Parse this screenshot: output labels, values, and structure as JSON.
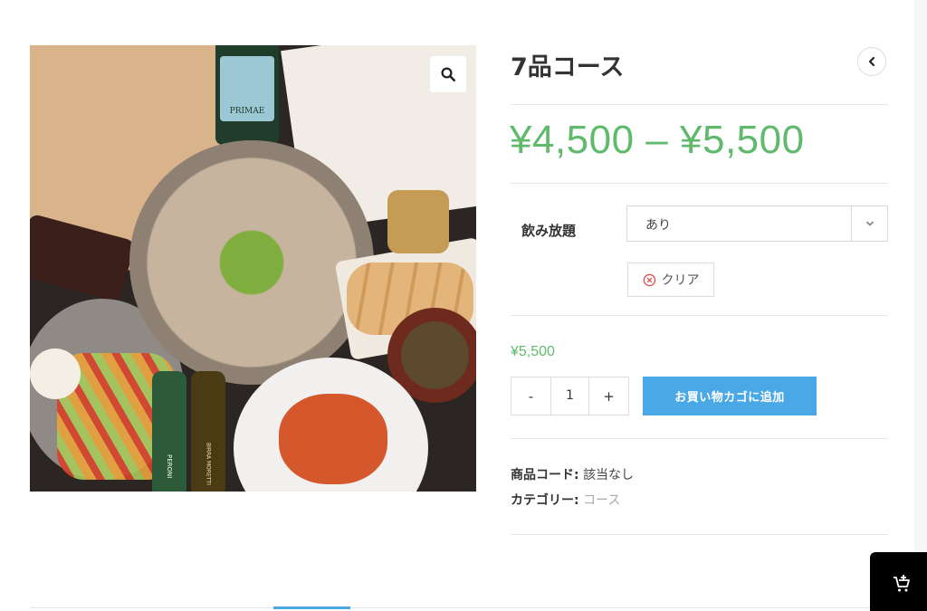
{
  "product": {
    "title": "7品コース",
    "price_range": "¥4,500 – ¥5,500",
    "brand_accent": "#5fba6b",
    "button_color": "#4aa8e6"
  },
  "variation": {
    "label": "飲み放題",
    "selected": "あり",
    "clear_label": "クリア",
    "price": "¥5,500"
  },
  "cart": {
    "minus": "-",
    "quantity": "1",
    "plus": "+",
    "add_to_cart_label": "お買い物カゴに追加"
  },
  "meta": {
    "sku_label": "商品コード:",
    "sku_value": "該当なし",
    "category_label": "カテゴリー:",
    "category_value": "コース"
  },
  "image": {
    "bottle_label_text": "PRIMAE",
    "beer1_text": "PERONI",
    "beer2_text": "BIRRA MORETTI"
  },
  "icons": {
    "zoom": "magnifier-icon",
    "back": "chevron-left-icon",
    "select_arrow": "chevron-down-icon",
    "clear": "circle-x-icon",
    "float_cart": "add-cart-icon"
  }
}
